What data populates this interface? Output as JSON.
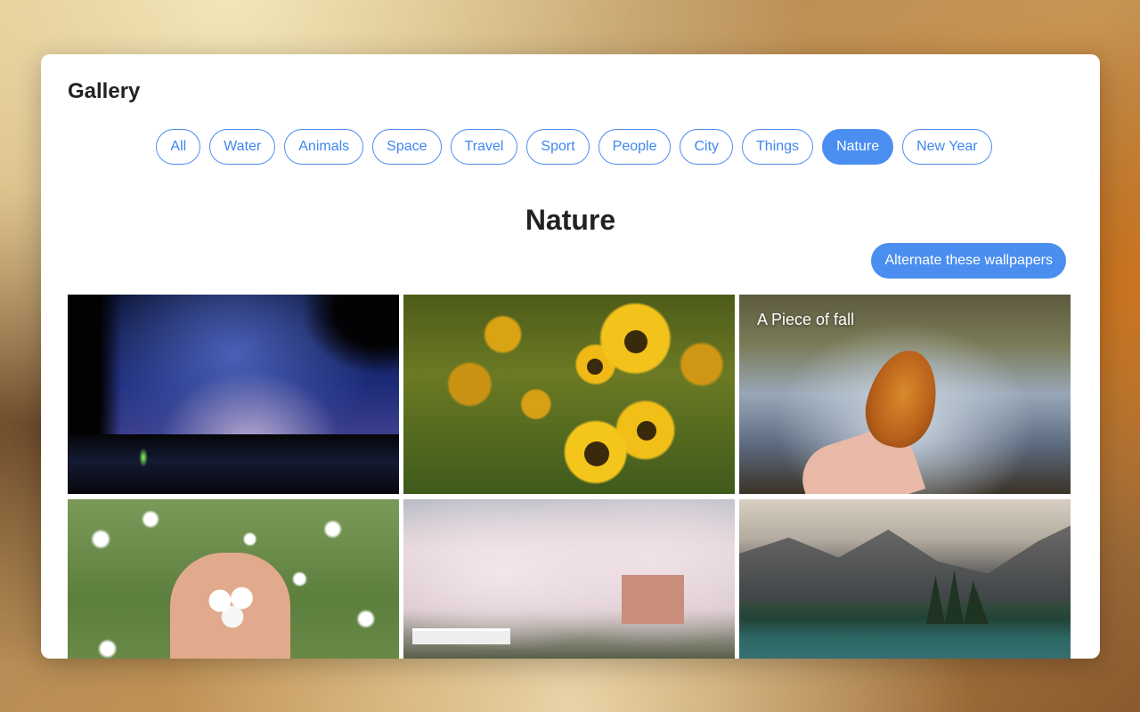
{
  "app": {
    "title": "Gallery"
  },
  "filters": [
    {
      "label": "All",
      "active": false
    },
    {
      "label": "Water",
      "active": false
    },
    {
      "label": "Animals",
      "active": false
    },
    {
      "label": "Space",
      "active": false
    },
    {
      "label": "Travel",
      "active": false
    },
    {
      "label": "Sport",
      "active": false
    },
    {
      "label": "People",
      "active": false
    },
    {
      "label": "City",
      "active": false
    },
    {
      "label": "Things",
      "active": false
    },
    {
      "label": "Nature",
      "active": true
    },
    {
      "label": "New Year",
      "active": false
    }
  ],
  "section": {
    "title": "Nature",
    "action_label": "Alternate these wallpapers"
  },
  "tiles": [
    {
      "name": "night-sky-lake",
      "caption": ""
    },
    {
      "name": "sunflowers",
      "caption": ""
    },
    {
      "name": "fall-leaf",
      "caption": "A Piece of fall"
    },
    {
      "name": "hands-blossoms",
      "caption": ""
    },
    {
      "name": "cherry-blossom-trees",
      "caption": ""
    },
    {
      "name": "mountain-lake",
      "caption": ""
    }
  ],
  "colors": {
    "accent": "#4a8ef0",
    "text": "#222222"
  }
}
